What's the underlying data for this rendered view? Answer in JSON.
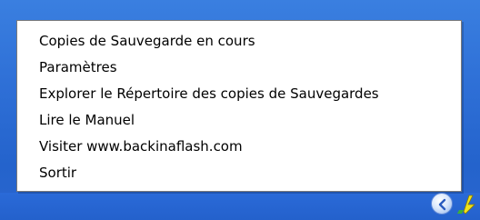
{
  "context_menu": {
    "items": [
      {
        "label": "Copies de Sauvegarde en cours"
      },
      {
        "label": "Paramètres"
      },
      {
        "label": "Explorer le Répertoire des copies de Sauvegardes"
      },
      {
        "label": "Lire le Manuel"
      },
      {
        "label": "Visiter www.backinaflash.com"
      },
      {
        "label": "Sortir"
      }
    ]
  },
  "tray": {
    "chevron_icon": "chevron-left-icon",
    "app_icon": "backinaflash-tray-icon"
  },
  "colors": {
    "desktop": "#2e6fd6",
    "menu_background": "#ffffff",
    "menu_text": "#000000",
    "menu_border": "#7a7a7a"
  }
}
